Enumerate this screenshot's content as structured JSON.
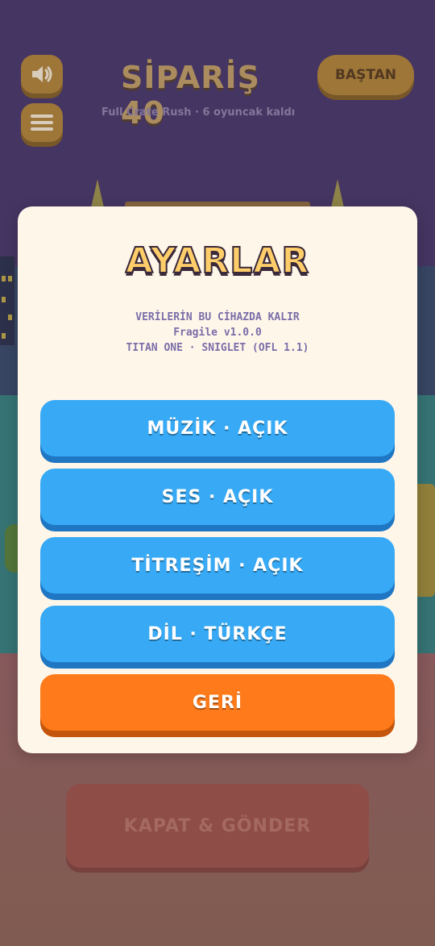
{
  "hud": {
    "title": "SİPARİŞ 40",
    "subtitle": "Full Crate Rush · 6 oyuncak kaldı",
    "restart_label": "BAŞTAN",
    "sound_icon": "speaker-icon",
    "menu_icon": "hamburger-icon"
  },
  "footer": {
    "close_send_label": "KAPAT & GÖNDER"
  },
  "settings": {
    "title": "AYARLAR",
    "info_line1": "VERİLERİN BU CİHAZDA KALIR",
    "info_line2": "Fragile v1.0.0",
    "info_line3": "TITAN ONE · SNIGLET (OFL 1.1)",
    "music_label": "MÜZİK · AÇIK",
    "sound_label": "SES · AÇIK",
    "vibration_label": "TİTREŞİM · AÇIK",
    "language_label": "DİL · TÜRKÇE",
    "back_label": "GERİ"
  },
  "colors": {
    "button_blue": "#37a9f5",
    "button_orange": "#ff7a1a",
    "modal_bg": "#fff6ea",
    "title_yellow": "#ffce6a"
  }
}
